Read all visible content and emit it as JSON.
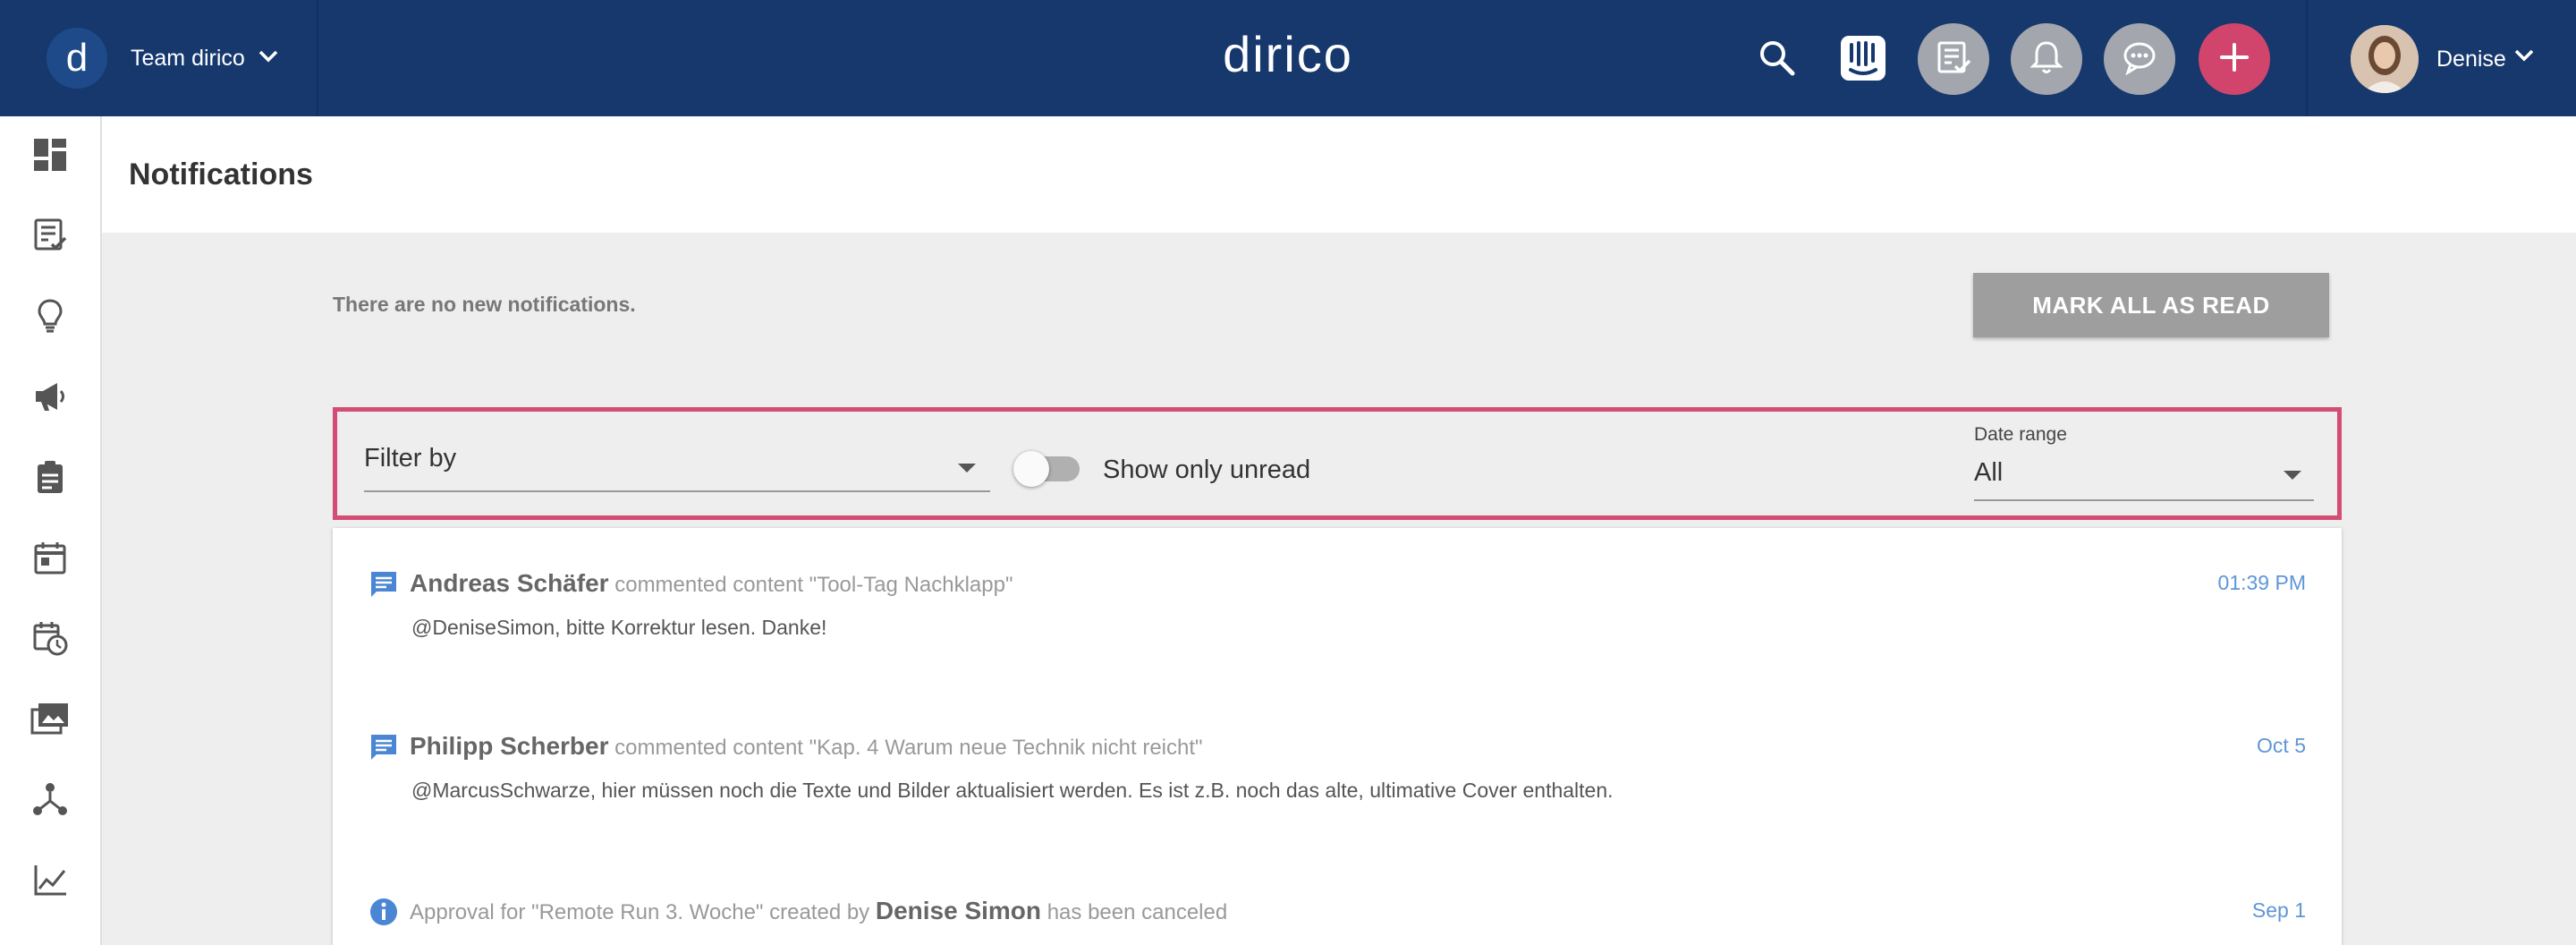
{
  "header": {
    "team_name": "Team dirico",
    "team_logo_letter": "d",
    "brand": "dirico",
    "user_name": "Denise"
  },
  "page": {
    "title": "Notifications",
    "empty_message": "There are no new notifications.",
    "mark_all_label": "MARK ALL AS READ"
  },
  "filters": {
    "filter_by_label": "Filter by",
    "unread_label": "Show only unread",
    "unread_on": false,
    "date_range_label": "Date range",
    "date_range_value": "All"
  },
  "notifications": [
    {
      "type": "comment",
      "actor": "Andreas Schäfer",
      "action": "commented content \"Tool-Tag Nachklapp\"",
      "body": "@DeniseSimon, bitte Korrektur lesen. Danke!",
      "time": "01:39 PM"
    },
    {
      "type": "comment",
      "actor": "Philipp Scherber",
      "action": "commented content \"Kap. 4 Warum neue Technik nicht reicht\"",
      "body": "@MarcusSchwarze, hier müssen noch die Texte und Bilder aktualisiert werden. Es ist z.B. noch das alte, ultimative Cover enthalten.",
      "time": "Oct 5"
    },
    {
      "type": "info",
      "prefix": "Approval for \"Remote Run 3. Woche\" created by",
      "actor": "Denise Simon",
      "suffix": "has been canceled",
      "time": "Sep 1"
    }
  ],
  "colors": {
    "topbar": "#17386d",
    "accent_pink": "#d1456c",
    "link_blue": "#5f96d6",
    "filter_outline": "#d44d74"
  },
  "icons": {
    "sidebar": [
      "dashboard-icon",
      "content-icon",
      "ideas-icon",
      "campaigns-icon",
      "tasks-icon",
      "calendar-icon",
      "schedule-icon",
      "media-icon",
      "workflow-icon",
      "analytics-icon"
    ],
    "topbar": [
      "search-icon",
      "intercom-icon",
      "content-review-icon",
      "bell-icon",
      "chat-icon",
      "plus-icon"
    ]
  }
}
